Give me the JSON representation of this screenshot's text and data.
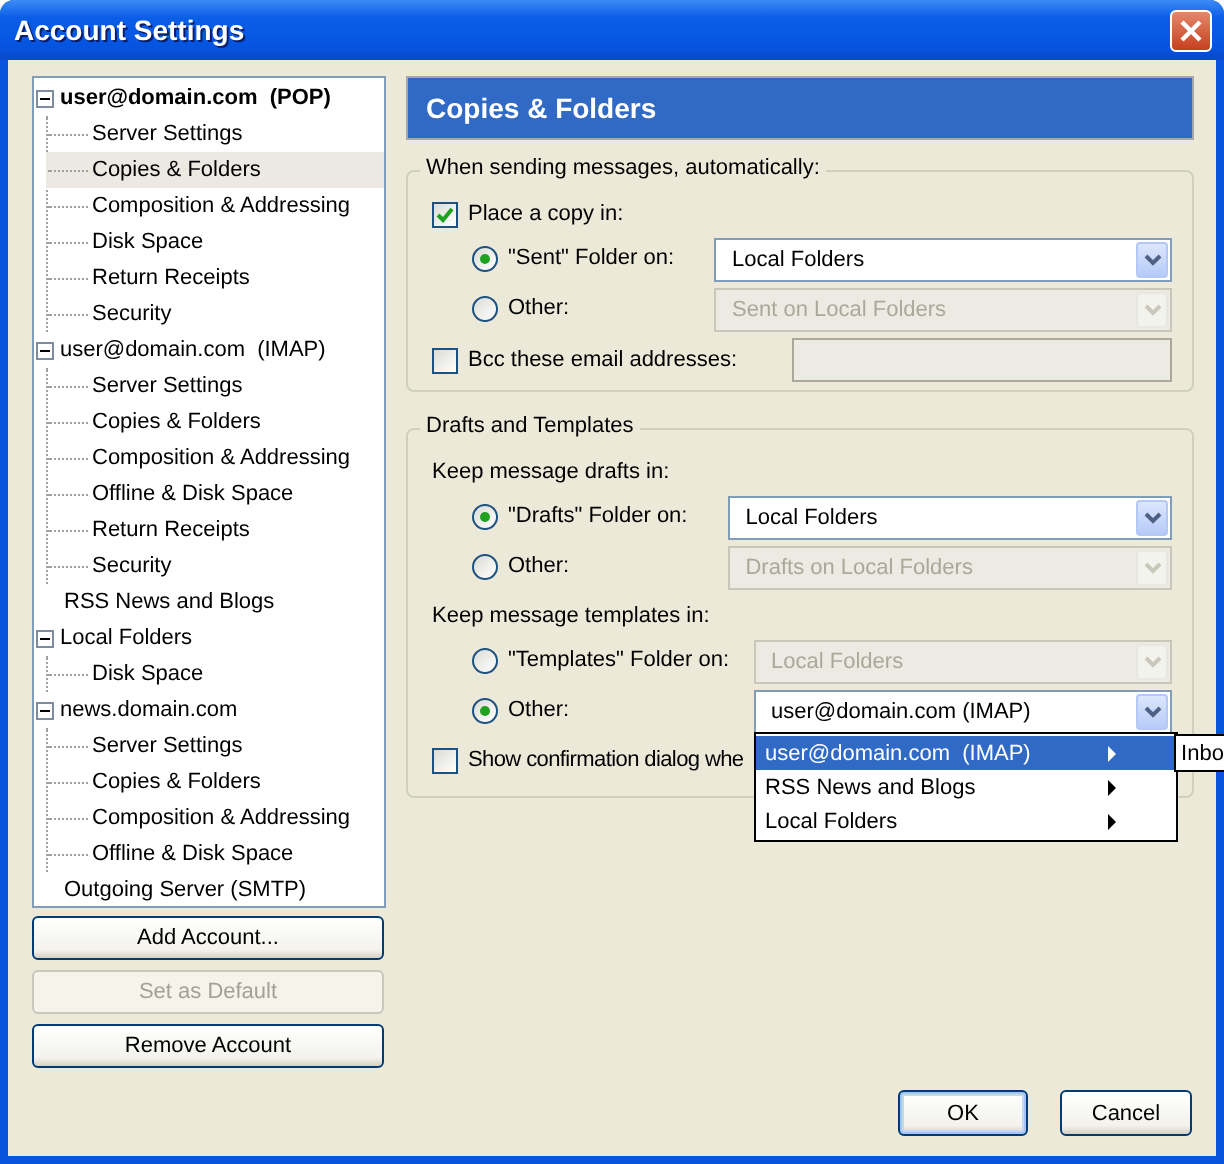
{
  "window": {
    "title": "Account Settings"
  },
  "sidebar": {
    "tree": [
      {
        "label": "user@domain.com  (POP)",
        "default": true,
        "expanded": true,
        "selected": false,
        "children": [
          {
            "label": "Server Settings",
            "selected": false
          },
          {
            "label": "Copies & Folders",
            "selected": true
          },
          {
            "label": "Composition & Addressing",
            "selected": false
          },
          {
            "label": "Disk Space",
            "selected": false
          },
          {
            "label": "Return Receipts",
            "selected": false
          },
          {
            "label": "Security",
            "selected": false
          }
        ]
      },
      {
        "label": "user@domain.com  (IMAP)",
        "default": false,
        "expanded": true,
        "selected": false,
        "children": [
          {
            "label": "Server Settings",
            "selected": false
          },
          {
            "label": "Copies & Folders",
            "selected": false
          },
          {
            "label": "Composition & Addressing",
            "selected": false
          },
          {
            "label": "Offline & Disk Space",
            "selected": false
          },
          {
            "label": "Return Receipts",
            "selected": false
          },
          {
            "label": "Security",
            "selected": false
          }
        ]
      },
      {
        "label": "RSS News and Blogs",
        "default": false,
        "selected": false
      },
      {
        "label": "Local Folders",
        "default": false,
        "expanded": true,
        "selected": false,
        "children": [
          {
            "label": "Disk Space",
            "selected": false
          }
        ]
      },
      {
        "label": "news.domain.com",
        "default": false,
        "expanded": true,
        "selected": false,
        "children": [
          {
            "label": "Server Settings",
            "selected": false
          },
          {
            "label": "Copies & Folders",
            "selected": false
          },
          {
            "label": "Composition & Addressing",
            "selected": false
          },
          {
            "label": "Offline & Disk Space",
            "selected": false
          }
        ]
      },
      {
        "label": "Outgoing Server (SMTP)",
        "default": false,
        "selected": false
      }
    ],
    "buttons": [
      {
        "label": "Add Account...",
        "disabled": false
      },
      {
        "label": "Set as Default",
        "disabled": true
      },
      {
        "label": "Remove Account",
        "disabled": false
      }
    ]
  },
  "panel": {
    "title": "Copies & Folders",
    "sending": {
      "legend": "When sending messages, automatically:",
      "place_copy": {
        "label": "Place a copy in:",
        "checked": true
      },
      "options": [
        {
          "label": "\"Sent\" Folder on:",
          "selected": true,
          "combo": {
            "value": "Local Folders",
            "disabled": false
          }
        },
        {
          "label": "Other:",
          "selected": false,
          "combo": {
            "value": "Sent on Local Folders",
            "disabled": true
          }
        }
      ],
      "bcc": {
        "label": "Bcc these email addresses:",
        "checked": false,
        "field_disabled": true
      }
    },
    "drafts": {
      "legend": "Drafts and Templates",
      "groups": [
        {
          "heading": "Keep message drafts in:",
          "options": [
            {
              "label": "\"Drafts\" Folder on:",
              "selected": true,
              "combo": {
                "value": "Local Folders",
                "disabled": false
              }
            },
            {
              "label": "Other:",
              "selected": false,
              "combo": {
                "value": "Drafts on Local Folders",
                "disabled": true
              }
            }
          ]
        },
        {
          "heading": "Keep message templates in:",
          "options": [
            {
              "label": "\"Templates\" Folder on:",
              "selected": false,
              "combo": {
                "value": "Local Folders",
                "disabled": true
              }
            },
            {
              "label": "Other:",
              "selected": true,
              "combo": {
                "value": "user@domain.com  (IMAP)",
                "disabled": false
              }
            }
          ]
        }
      ],
      "confirm": {
        "label": "Show confirmation dialog whe",
        "checked": false
      }
    },
    "menu": {
      "items": [
        {
          "label": "user@domain.com  (IMAP)",
          "selected": true
        },
        {
          "label": "RSS News and Blogs",
          "selected": false
        },
        {
          "label": "Local Folders",
          "selected": false
        }
      ],
      "submenu": {
        "items": [
          {
            "label": "Inbo"
          }
        ]
      }
    }
  },
  "dialog_buttons": [
    {
      "label": "OK",
      "default": true
    },
    {
      "label": "Cancel",
      "default": false
    }
  ]
}
